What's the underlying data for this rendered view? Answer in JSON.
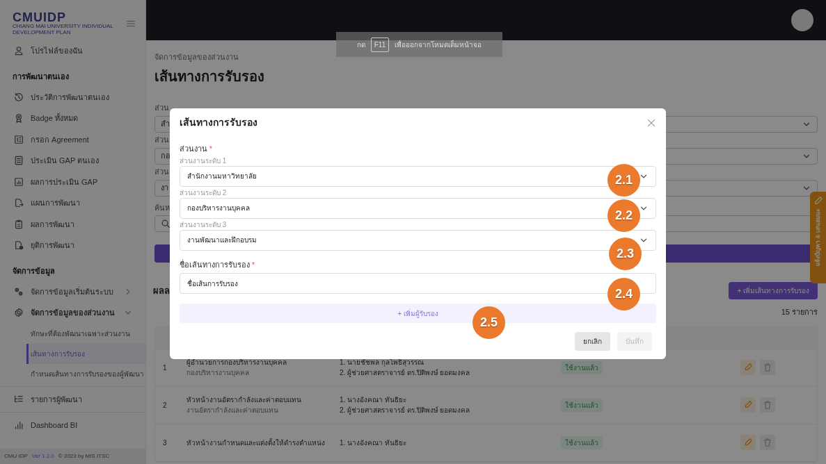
{
  "sidebar": {
    "logo": "CMUIDP",
    "logo_subtitle": "CHIANG MAI UNIVERSITY INDIVIDUAL DEVELOPMENT PLAN",
    "items": [
      {
        "kind": "link",
        "label": "โปรไฟล์ของฉัน"
      },
      {
        "kind": "section",
        "label": "การพัฒนาตนเอง"
      },
      {
        "kind": "link",
        "label": "ประวัติการพัฒนาตนเอง"
      },
      {
        "kind": "link",
        "label": "Badge ทั้งหมด"
      },
      {
        "kind": "link",
        "label": "กรอก Agreement"
      },
      {
        "kind": "link",
        "label": "ประเมิน GAP ตนเอง"
      },
      {
        "kind": "link",
        "label": "ผลการประเมิน GAP"
      },
      {
        "kind": "link",
        "label": "แผนการพัฒนา"
      },
      {
        "kind": "link",
        "label": "ผลการพัฒนา"
      },
      {
        "kind": "link",
        "label": "ยุติการพัฒนา"
      },
      {
        "kind": "section",
        "label": "จัดการข้อมูล"
      },
      {
        "kind": "group",
        "label": "จัดการข้อมูลเริ่มต้นระบบ",
        "expanded": false
      },
      {
        "kind": "group",
        "label": "จัดการข้อมูลของส่วนงาน",
        "expanded": true,
        "children": [
          {
            "label": "ทักษะที่ต้องพัฒนาเฉพาะส่วนงาน",
            "selected": false
          },
          {
            "label": "เส้นทางการรับรอง",
            "selected": true
          },
          {
            "label": "กำหนดเส้นทางการรับรองของผู้พัฒนา",
            "selected": false
          }
        ]
      },
      {
        "kind": "link",
        "label": "รายการผู้พัฒนา"
      },
      {
        "kind": "link",
        "label": "Dashboard BI"
      }
    ],
    "footer": {
      "app": "CMU IDP",
      "version": "Ver 1.2.0",
      "copyright": "© 2023 by MIS ITSC"
    }
  },
  "fullscreen_hint": {
    "before": "กด",
    "key": "F11",
    "after": "เพื่อออกจากโหมดเต็มหน้าจอ"
  },
  "page": {
    "breadcrumb": "จัดการข้อมูลของส่วนงาน",
    "title": "เส้นทางการรับรอง",
    "filters": [
      {
        "label": "ส่วน",
        "value": "สำ"
      },
      {
        "label": "ส่วน",
        "value": "กอ"
      },
      {
        "label": "ส่วน",
        "value": "งา"
      }
    ],
    "search_label": "ค้นห",
    "results_heading": "ผลล",
    "add_button": "+ เพิ่มเส้นทางการรับรอง",
    "count": "15 รายการ",
    "rows": [
      {
        "no": "1",
        "name": "ผู้อำนวยการกองบริหารงานบุคคล",
        "unit": "กองบริหารงานบุคคล",
        "approvers": [
          "1. นายชัชพล กุลโพธิสุวรรณ",
          "2. ผู้ช่วยศาสตราจารย์ ดร.ปิติพงษ์ ยอดมงคล"
        ],
        "status": "ใช้งานแล้ว"
      },
      {
        "no": "2",
        "name": "หัวหน้างานอัตรากำลังและค่าตอบแทน",
        "unit": "งานอัตรากำลังและค่าตอบแทน",
        "approvers": [
          "1. นางอังคณา ทันธิยะ",
          "2. ผู้ช่วยศาสตราจารย์ ดร.ปิติพงษ์ ยอดมงคล"
        ],
        "status": "ใช้งานแล้ว"
      },
      {
        "no": "3",
        "name": "หัวหน้างานกำหนดและแต่งตั้งให้ดำรงตำแหน่ง",
        "unit": "",
        "approvers": [
          "1. นางอังคณา ทันธิยะ"
        ],
        "status": "ใช้งานแล้ว"
      }
    ]
  },
  "feedback_tab": "แจ้งปัญหา & เสนอแนะ",
  "modal": {
    "title": "เส้นทางการรับรอง",
    "section_label": "ส่วนงาน",
    "required_mark": "*",
    "selects": [
      {
        "label": "ส่วนงานระดับ 1",
        "value": "สำนักงานมหาวิทยาลัย",
        "marker": "2.1"
      },
      {
        "label": "ส่วนงานระดับ 2",
        "value": "กองบริหารงานบุคคล",
        "marker": "2.2"
      },
      {
        "label": "ส่วนงานระดับ 3",
        "value": "งานพัฒนาและฝึกอบรม",
        "marker": "2.3"
      }
    ],
    "name_label": "ชื่อเส้นทางการรับรอง",
    "name_value": "ชื่อเส้นการรับรอง",
    "name_marker": "2.4",
    "add_approver": "+ เพิ่มผู้รับรอง",
    "add_marker": "2.5",
    "buttons": [
      {
        "label": "ยกเลิก",
        "disabled": false
      },
      {
        "label": "บันทึก",
        "disabled": true
      }
    ]
  }
}
